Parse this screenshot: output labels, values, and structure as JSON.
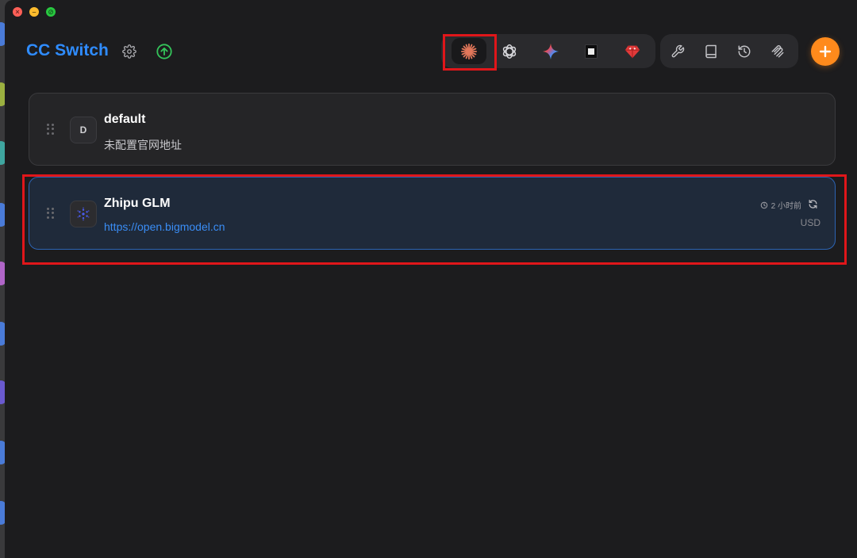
{
  "window": {
    "title": "CC Switch",
    "controls": [
      "close",
      "minimize",
      "maximize"
    ]
  },
  "header": {
    "settings_icon": "gear-icon",
    "update_icon": "arrow-up-circle-icon"
  },
  "app_tabs": [
    {
      "name": "claude",
      "icon": "claude-starburst-icon",
      "active": true
    },
    {
      "name": "codex",
      "icon": "openai-icon",
      "active": false
    },
    {
      "name": "gemini",
      "icon": "gemini-sparkle-icon",
      "active": false
    },
    {
      "name": "opencode",
      "icon": "square-icon",
      "active": false
    },
    {
      "name": "red-agent",
      "icon": "red-gem-icon",
      "active": false
    }
  ],
  "tools": [
    {
      "name": "wrench",
      "icon": "wrench-icon"
    },
    {
      "name": "book",
      "icon": "book-icon"
    },
    {
      "name": "history",
      "icon": "history-icon"
    },
    {
      "name": "mcp",
      "icon": "mcp-icon"
    }
  ],
  "add_button_icon": "plus-icon",
  "providers": [
    {
      "avatar": "D",
      "name": "default",
      "subtitle": "未配置官网地址",
      "active": false
    },
    {
      "avatar_icon": "zhipu-icon",
      "name": "Zhipu GLM",
      "url": "https://open.bigmodel.cn",
      "time": "2 小时前",
      "currency": "USD",
      "active": true
    }
  ],
  "colors": {
    "accent": "#2f8cff",
    "add_button": "#ff8a1c",
    "highlight": "#e0161a",
    "active_card_border": "#2c64b4"
  }
}
